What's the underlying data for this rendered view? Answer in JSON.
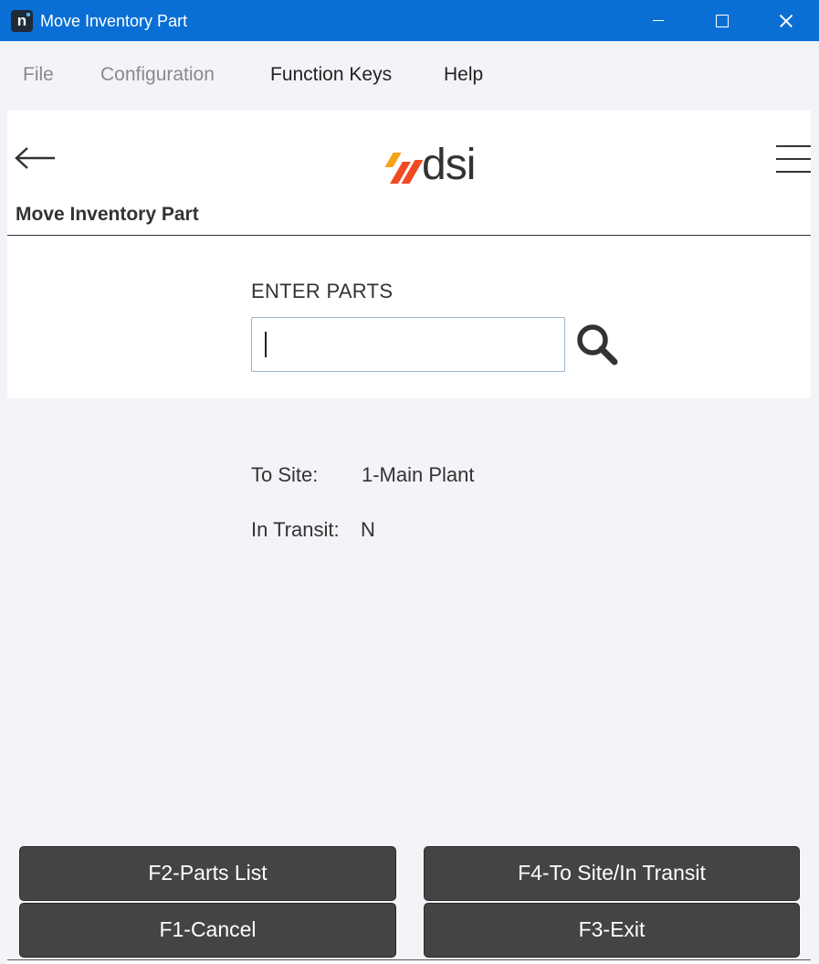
{
  "window": {
    "title": "Move Inventory Part",
    "app_icon_letter": "n"
  },
  "menu": {
    "items": [
      {
        "label": "File",
        "enabled": false
      },
      {
        "label": "Configuration",
        "enabled": false
      },
      {
        "label": "Function Keys",
        "enabled": true
      },
      {
        "label": "Help",
        "enabled": true
      }
    ]
  },
  "header": {
    "logo_text": "dsi",
    "logo_colors": [
      "#f7a21b",
      "#ef4a23"
    ],
    "page_title": "Move Inventory Part",
    "icons": [
      "back-arrow-icon",
      "hamburger-menu-icon"
    ]
  },
  "entry": {
    "label": "ENTER PARTS",
    "value": "",
    "placeholder": "",
    "search_icon": "search-icon"
  },
  "info": {
    "to_site_label": "To Site:",
    "to_site_value": "1-Main Plant",
    "in_transit_label": "In Transit:",
    "in_transit_value": "N"
  },
  "function_keys": {
    "f2": "F2-Parts List",
    "f4": "F4-To Site/In Transit",
    "f1": "F1-Cancel",
    "f3": "F3-Exit"
  },
  "colors": {
    "titlebar": "#0a6fd4",
    "button_bg": "#444444",
    "page_bg": "#f3f4f8"
  }
}
